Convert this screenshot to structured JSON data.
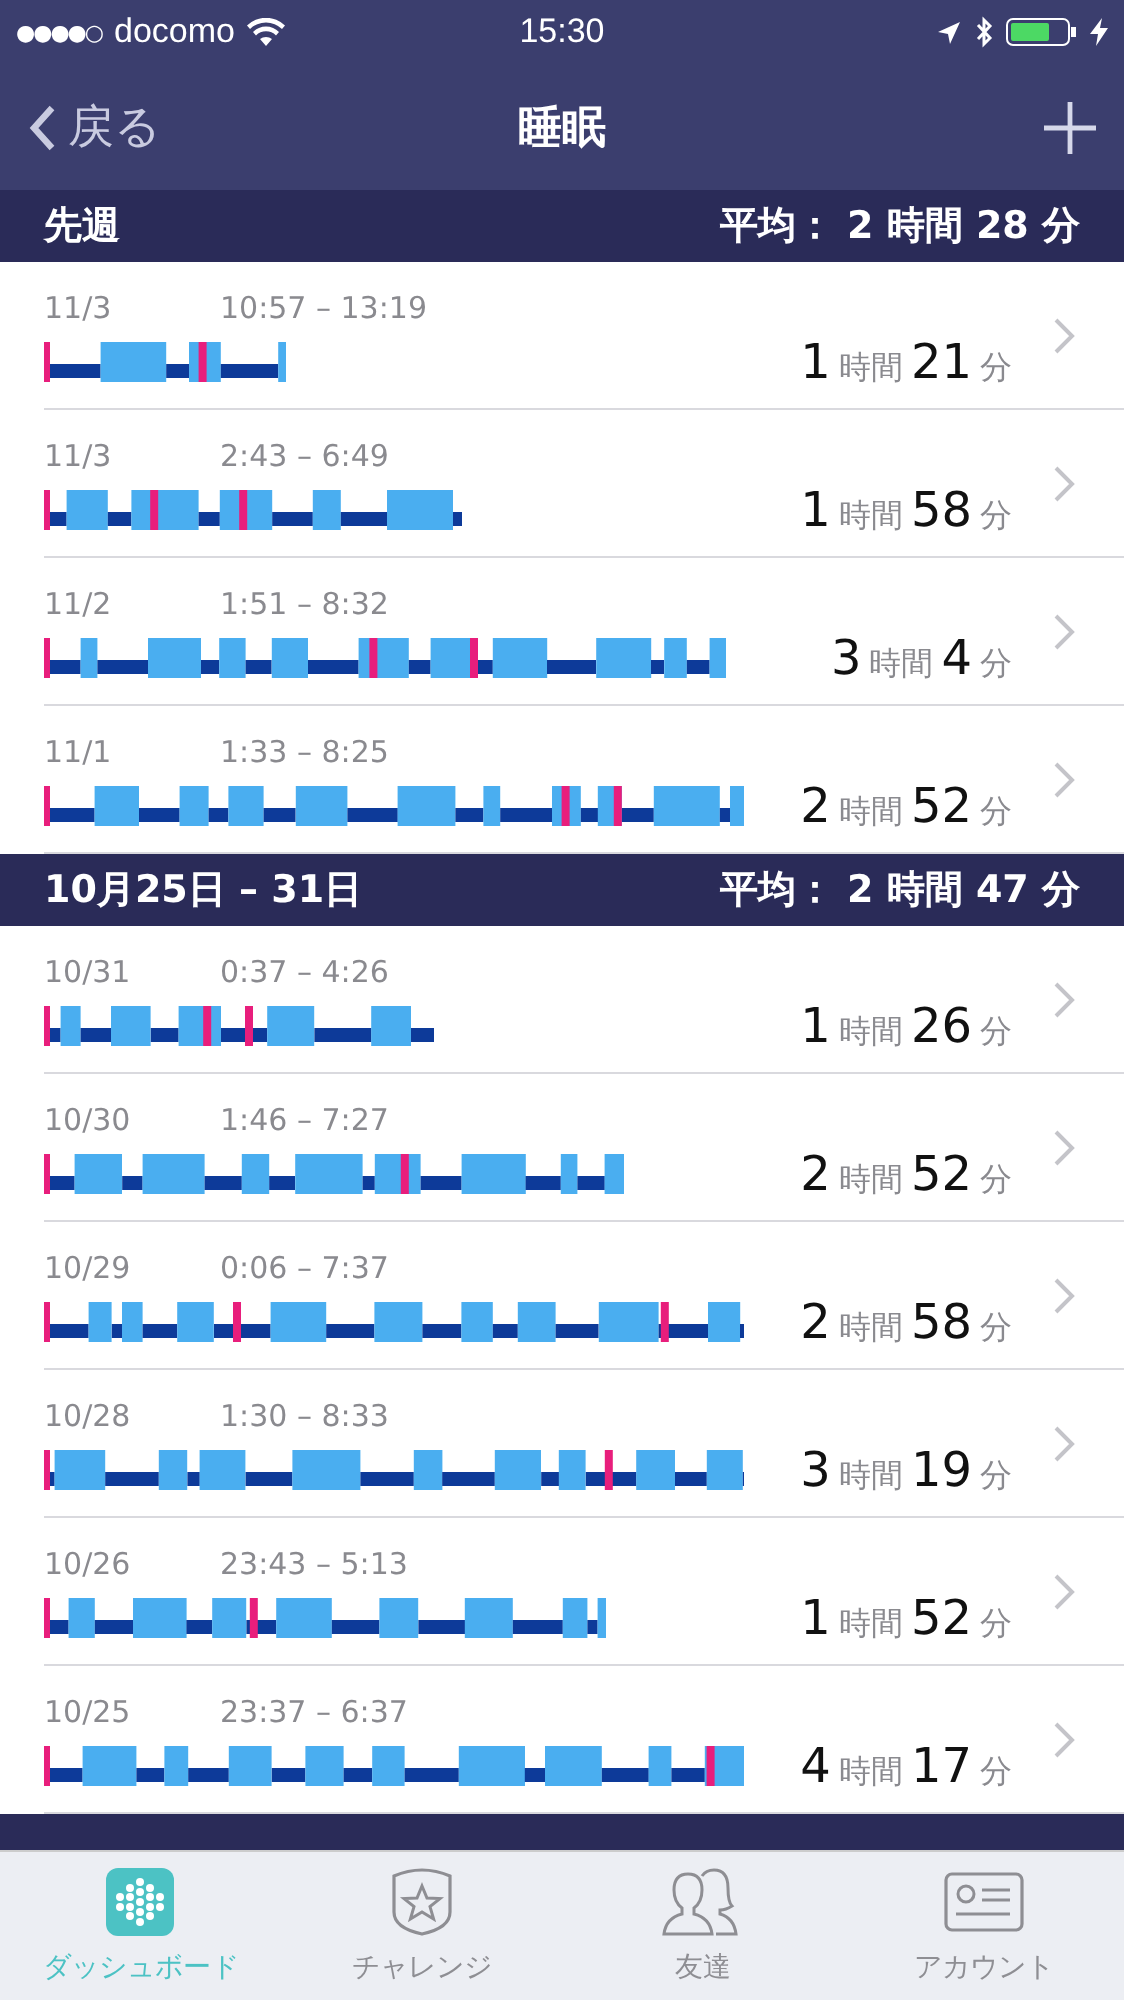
{
  "status_bar": {
    "signal_dots": "●●●●○",
    "carrier": "docomo",
    "time": "15:30"
  },
  "nav": {
    "back": "戻る",
    "title": "睡眠"
  },
  "sections": [
    {
      "title": "先週",
      "average": "平均： 2 時間 28 分",
      "entries": [
        {
          "date": "11/3",
          "range": "10:57 – 13:19",
          "hours": "1",
          "hours_unit": "時間",
          "minutes": "21",
          "minutes_unit": "分"
        },
        {
          "date": "11/3",
          "range": "2:43 – 6:49",
          "hours": "1",
          "hours_unit": "時間",
          "minutes": "58",
          "minutes_unit": "分"
        },
        {
          "date": "11/2",
          "range": "1:51 – 8:32",
          "hours": "3",
          "hours_unit": "時間",
          "minutes": "4",
          "minutes_unit": "分"
        },
        {
          "date": "11/1",
          "range": "1:33 – 8:25",
          "hours": "2",
          "hours_unit": "時間",
          "minutes": "52",
          "minutes_unit": "分"
        }
      ]
    },
    {
      "title": "10月25日 – 31日",
      "average": "平均： 2 時間 47 分",
      "entries": [
        {
          "date": "10/31",
          "range": "0:37 – 4:26",
          "hours": "1",
          "hours_unit": "時間",
          "minutes": "26",
          "minutes_unit": "分"
        },
        {
          "date": "10/30",
          "range": "1:46 – 7:27",
          "hours": "2",
          "hours_unit": "時間",
          "minutes": "52",
          "minutes_unit": "分"
        },
        {
          "date": "10/29",
          "range": "0:06 – 7:37",
          "hours": "2",
          "hours_unit": "時間",
          "minutes": "58",
          "minutes_unit": "分"
        },
        {
          "date": "10/28",
          "range": "1:30 – 8:33",
          "hours": "3",
          "hours_unit": "時間",
          "minutes": "19",
          "minutes_unit": "分"
        },
        {
          "date": "10/26",
          "range": "23:43 – 5:13",
          "hours": "1",
          "hours_unit": "時間",
          "minutes": "52",
          "minutes_unit": "分"
        },
        {
          "date": "10/25",
          "range": "23:37 – 6:37",
          "hours": "4",
          "hours_unit": "時間",
          "minutes": "17",
          "minutes_unit": "分"
        }
      ]
    }
  ],
  "tab_bar": [
    {
      "kind": "dashboard",
      "label": "ダッシュボード",
      "selected": true
    },
    {
      "kind": "challenge",
      "label": "チャレンジ",
      "selected": false
    },
    {
      "kind": "friends",
      "label": "友達",
      "selected": false
    },
    {
      "kind": "account",
      "label": "アカウント",
      "selected": false
    }
  ]
}
